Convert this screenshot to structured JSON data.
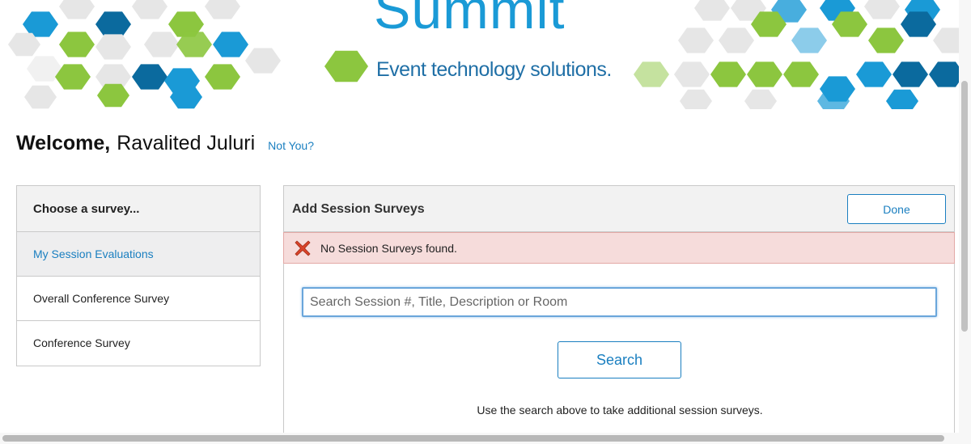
{
  "banner": {
    "brand_title": "Summit",
    "tagline": "Event technology solutions.",
    "colors": {
      "light_blue": "#1a9ad6",
      "dark_blue": "#0b6a9e",
      "green": "#8cc63f",
      "gray": "#e6e6e6"
    }
  },
  "welcome": {
    "greeting": "Welcome,",
    "user_name": "Ravalited Juluri",
    "not_you_link": "Not You?"
  },
  "sidebar": {
    "heading": "Choose a survey...",
    "items": [
      {
        "label": "My Session Evaluations",
        "active": true
      },
      {
        "label": "Overall Conference Survey",
        "active": false
      },
      {
        "label": "Conference Survey",
        "active": false
      }
    ]
  },
  "main": {
    "title": "Add Session Surveys",
    "done_label": "Done",
    "alert": {
      "icon": "error-x-icon",
      "text": "No Session Surveys found."
    },
    "search": {
      "placeholder": "Search Session #, Title, Description or Room",
      "value": "",
      "button_label": "Search"
    },
    "hint": "Use the search above to take additional session surveys."
  },
  "accent_color": "#1a7fc0"
}
